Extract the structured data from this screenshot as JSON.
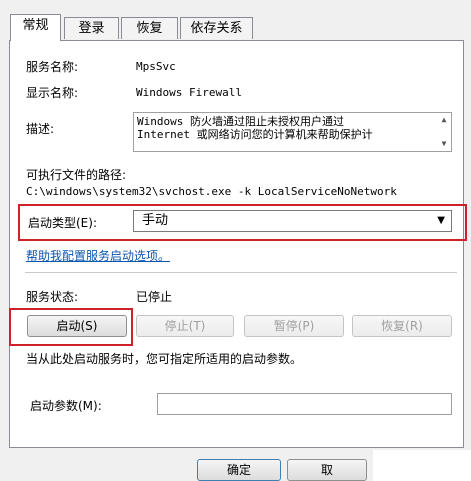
{
  "tabs": [
    {
      "label": "常规",
      "active": true
    },
    {
      "label": "登录",
      "active": false
    },
    {
      "label": "恢复",
      "active": false
    },
    {
      "label": "依存关系",
      "active": false
    }
  ],
  "general": {
    "service_name_label": "服务名称:",
    "service_name_value": "MpsSvc",
    "display_name_label": "显示名称:",
    "display_name_value": "Windows Firewall",
    "description_label": "描述:",
    "description_line1": "Windows 防火墙通过阻止未授权用户通过",
    "description_line2": "Internet 或网络访问您的计算机来帮助保护计",
    "exe_path_label": "可执行文件的路径:",
    "exe_path_value": "C:\\windows\\system32\\svchost.exe -k LocalServiceNoNetwork",
    "startup_type_label": "启动类型(E):",
    "startup_type_value": "手动",
    "help_link": "帮助我配置服务启动选项。",
    "service_status_label": "服务状态:",
    "service_status_value": "已停止",
    "hint_text": "当从此处启动服务时，您可指定所适用的启动参数。",
    "start_params_label": "启动参数(M):",
    "start_params_value": ""
  },
  "service_buttons": {
    "start": "启动(S)",
    "stop": "停止(T)",
    "pause": "暂停(P)",
    "resume": "恢复(R)"
  },
  "dialog_buttons": {
    "ok": "确定",
    "cancel": "取"
  },
  "colors": {
    "highlight_box": "#d0202a",
    "link": "#0b56b0"
  }
}
